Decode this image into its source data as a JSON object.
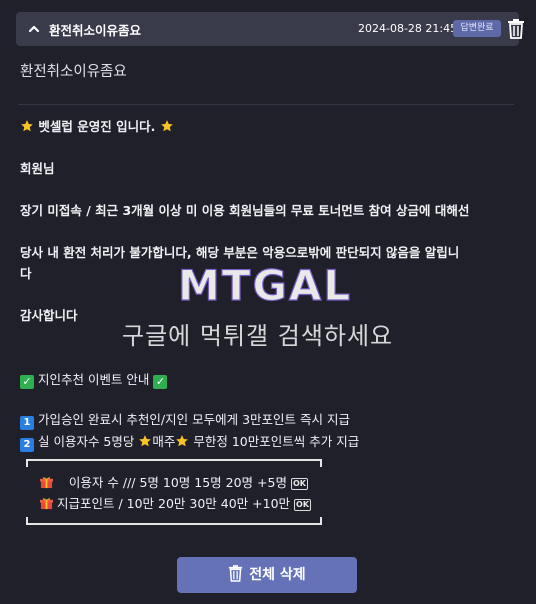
{
  "post": {
    "title": "환전취소이유좀요",
    "datetime": "2024-08-28 21:45",
    "status_badge": "답변완료",
    "subject": "환전취소이유좀요"
  },
  "answer": {
    "greeting": "벳셀럽 운영진 입니다.",
    "salutation": "회원님",
    "para1": "장기 미접속 / 최근 3개월 이상 미 이용 회원님들의 무료 토너먼트 참여 상금에 대해선",
    "para2_line1": "당사 내 환전 처리가 불가합니다, 해당 부분은 악용으로밖에 판단되지 않음을 알립니",
    "para2_line2": "다",
    "thanks": "감사합니다"
  },
  "event": {
    "title": "지인추천 이벤트 안내",
    "item1_num": "1",
    "item1": "가입승인 완료시 추천인/지인 모두에게 3만포인트 즉시 지급",
    "item2_num": "2",
    "item2_pre": "실 이용자수 5명당",
    "item2_mid": "매주",
    "item2_post": "무한정 10만포인트씩 추가 지급",
    "table_row1": "이용자 수 /// 5명 10명 15명 20명 +5명",
    "table_row2": "지급포인트 / 10만 20만 30만 40만 +10만",
    "ok_label": "OK"
  },
  "watermark": {
    "logo_text": "MTGAL",
    "text": "구글에 먹튀갤 검색하세요"
  },
  "actions": {
    "delete_all": "전체 삭제"
  },
  "colors": {
    "background": "#1f2029",
    "header": "#393b4a",
    "badge": "#5e6aa8",
    "button": "#6572b8"
  },
  "icons": [
    "chevron-up-icon",
    "trash-icon",
    "star-icon",
    "check-icon",
    "gift-icon",
    "ok-icon"
  ]
}
